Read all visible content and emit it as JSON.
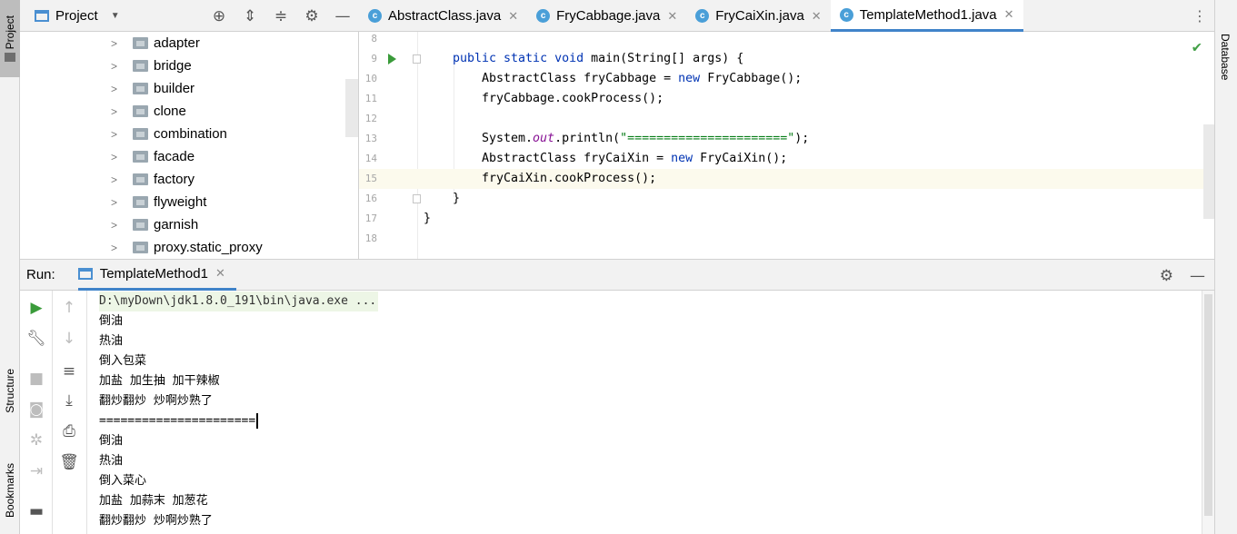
{
  "left_strip": {
    "project_tab": "Project",
    "structure_tab": "Structure",
    "bookmarks_tab": "Bookmarks"
  },
  "right_strip": {
    "database_tab": "Database"
  },
  "project": {
    "title": "Project",
    "header_icons": [
      "locate-icon",
      "expand-all-icon",
      "collapse-all-icon",
      "gear-icon",
      "minimize-icon"
    ],
    "tree": [
      {
        "label": "adapter"
      },
      {
        "label": "bridge"
      },
      {
        "label": "builder"
      },
      {
        "label": "clone"
      },
      {
        "label": "combination"
      },
      {
        "label": "facade"
      },
      {
        "label": "factory"
      },
      {
        "label": "flyweight"
      },
      {
        "label": "garnish"
      },
      {
        "label": "proxy.static_proxy"
      }
    ]
  },
  "editor": {
    "tabs": [
      {
        "label": "AbstractClass.java",
        "active": false
      },
      {
        "label": "FryCabbage.java",
        "active": false
      },
      {
        "label": "FryCaiXin.java",
        "active": false
      },
      {
        "label": "TemplateMethod1.java",
        "active": true
      }
    ],
    "lines": [
      {
        "num": "8",
        "code": ""
      },
      {
        "num": "9",
        "code": ""
      },
      {
        "num": "10",
        "code": ""
      },
      {
        "num": "11",
        "code": ""
      },
      {
        "num": "12",
        "code": ""
      },
      {
        "num": "13",
        "code": ""
      },
      {
        "num": "14",
        "code": ""
      },
      {
        "num": "15",
        "code": ""
      },
      {
        "num": "16",
        "code": ""
      },
      {
        "num": "17",
        "code": ""
      },
      {
        "num": "18",
        "code": ""
      }
    ],
    "code": {
      "l9_kw1": "public static void ",
      "l9_rest": "main(String[] args) {",
      "l10_a": "AbstractClass fryCabbage = ",
      "l10_kw": "new ",
      "l10_b": "FryCabbage();",
      "l11": "fryCabbage.cookProcess();",
      "l13_a": "System.",
      "l13_fld": "out",
      "l13_b": ".println(",
      "l13_str": "\"======================\"",
      "l13_c": ");",
      "l14_a": "AbstractClass fryCaiXin = ",
      "l14_kw": "new ",
      "l14_b": "FryCaiXin();",
      "l15": "fryCaiXin.cookProcess();",
      "l16": "}",
      "l17": "}"
    }
  },
  "run": {
    "label": "Run:",
    "tab_label": "TemplateMethod1",
    "console": [
      "D:\\myDown\\jdk1.8.0_191\\bin\\java.exe ...",
      "倒油",
      "热油",
      "倒入包菜",
      "加盐 加生抽 加干辣椒",
      "翻炒翻炒 炒啊炒熟了",
      "======================",
      "倒油",
      "热油",
      "倒入菜心",
      "加盐 加蒜末 加葱花",
      "翻炒翻炒 炒啊炒熟了"
    ]
  },
  "colors": {
    "accent": "#4083c9",
    "keyword": "#0033b3",
    "string": "#067d17",
    "field": "#871094",
    "run_green": "#3a9b3a"
  }
}
